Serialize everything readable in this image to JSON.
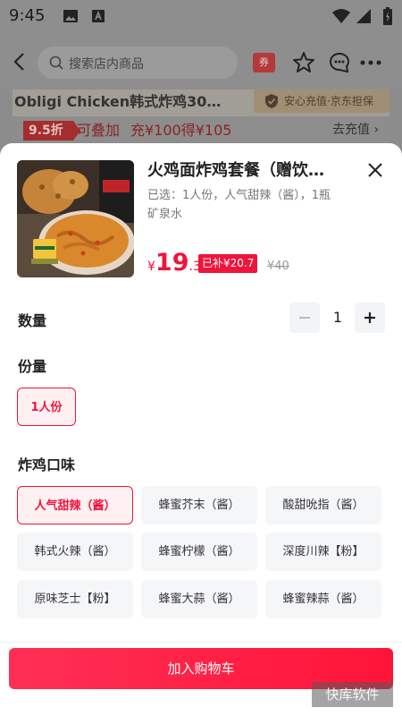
{
  "status_bar": {
    "time": "9:45"
  },
  "header": {
    "search_placeholder": "搜索店内商品",
    "coupon_label": "券"
  },
  "store": {
    "name": "Obligi Chicken韩式炸鸡30…",
    "badge": "安心充值·京东担保"
  },
  "promo": {
    "tag": "9.5折",
    "stackable": "可叠加",
    "offer": "充¥100得¥105",
    "action": "去充值 ›"
  },
  "product": {
    "title": "火鸡面炸鸡套餐（赠饮…",
    "selected": "已选：1人份，人气甜辣（酱），1瓶矿泉水",
    "price_currency": "¥",
    "price_int": "19",
    "price_dec": ".3",
    "subsidy": "已补¥20.7",
    "original_price": "¥40",
    "image_caption": "火鸡面炸鸡套餐"
  },
  "quantity": {
    "label": "数量",
    "value": "1",
    "minus": "−",
    "plus": "+"
  },
  "portion": {
    "label": "份量",
    "options": [
      "1人份"
    ]
  },
  "flavor": {
    "label": "炸鸡口味",
    "options": [
      "人气甜辣（酱）",
      "蜂蜜芥末（酱）",
      "酸甜吮指（酱）",
      "韩式火辣（酱）",
      "蜂蜜柠檬（酱）",
      "深度川辣【粉】",
      "原味芝士【粉】",
      "蜂蜜大蒜（酱）",
      "蜂蜜辣蒜（酱）"
    ]
  },
  "actions": {
    "add_to_cart": "加入购物车"
  },
  "watermark": "快库软件",
  "colors": {
    "accent": "#f0143c",
    "chip_bg": "#f5f6f8",
    "selected_chip_bg": "#fff0f2"
  }
}
